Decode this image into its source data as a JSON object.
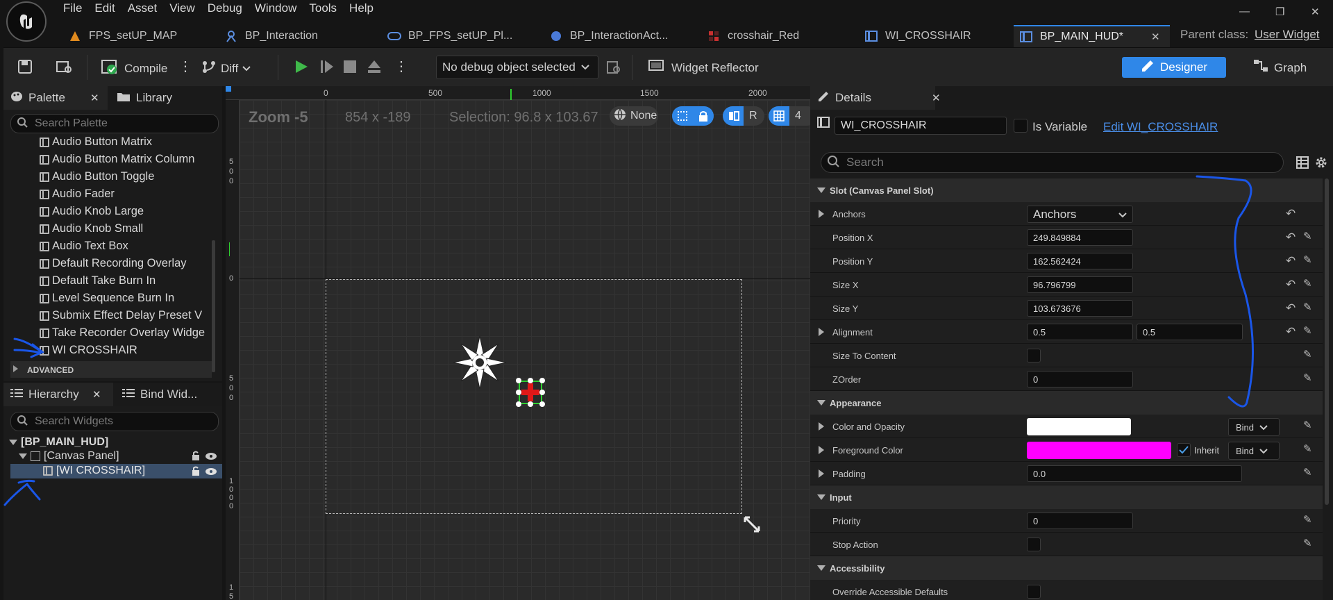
{
  "menu": [
    "File",
    "Edit",
    "Asset",
    "View",
    "Debug",
    "Window",
    "Tools",
    "Help"
  ],
  "window_buttons": {
    "minimize": "—",
    "restore": "❐",
    "close": "✕"
  },
  "tabs": [
    {
      "label": "FPS_setUP_MAP"
    },
    {
      "label": "BP_Interaction"
    },
    {
      "label": "BP_FPS_setUP_Pl..."
    },
    {
      "label": "BP_InteractionAct..."
    },
    {
      "label": "crosshair_Red"
    },
    {
      "label": "WI_CROSSHAIR"
    },
    {
      "label": "BP_MAIN_HUD*"
    }
  ],
  "tab_close": "✕",
  "parent_class": {
    "label": "Parent class:",
    "value": "User Widget"
  },
  "toolbar": {
    "compile": "Compile",
    "diff": "Diff",
    "debug_select": "No debug object selected",
    "widget_reflector": "Widget Reflector",
    "designer": "Designer",
    "graph": "Graph"
  },
  "palette": {
    "tab": "Palette",
    "library_tab": "Library",
    "close": "✕",
    "search_placeholder": "Search Palette",
    "items": [
      "Audio Button Matrix",
      "Audio Button Matrix Column",
      "Audio Button Toggle",
      "Audio Fader",
      "Audio Knob Large",
      "Audio Knob Small",
      "Audio Text Box",
      "Default Recording Overlay",
      "Default Take Burn In",
      "Level Sequence Burn In",
      "Submix Effect Delay Preset V",
      "Take Recorder Overlay Widge",
      "WI CROSSHAIR"
    ],
    "advanced": "ADVANCED"
  },
  "hierarchy": {
    "tab": "Hierarchy",
    "bind_tab": "Bind Wid...",
    "close": "✕",
    "search_placeholder": "Search Widgets",
    "root": "[BP_MAIN_HUD]",
    "canvas": "[Canvas Panel]",
    "child": "[WI CROSSHAIR]"
  },
  "viewport": {
    "zoom": "Zoom -5",
    "coords": "854 x -189",
    "selection": "Selection: 96.8 x 103.67",
    "none": "None",
    "r": "R",
    "grid_num": "4",
    "ruler_top": [
      "0",
      "500",
      "1000",
      "1500",
      "2000"
    ],
    "ruler_left": [
      [
        "5",
        "0",
        "0"
      ],
      [
        "0"
      ],
      [
        "5",
        "0",
        "0"
      ],
      [
        "1",
        "0",
        "0",
        "0"
      ],
      [
        "1",
        "5"
      ]
    ]
  },
  "details": {
    "tab": "Details",
    "close": "✕",
    "widget_name": "WI_CROSSHAIR",
    "is_variable": "Is Variable",
    "edit_link": "Edit WI_CROSSHAIR",
    "search_placeholder": "Search",
    "sections": {
      "slot": "Slot (Canvas Panel Slot)",
      "appearance": "Appearance",
      "input": "Input",
      "accessibility": "Accessibility"
    },
    "anchors_label": "Anchors",
    "anchors_value": "Anchors",
    "pos_x_label": "Position X",
    "pos_x": "249.849884",
    "pos_y_label": "Position Y",
    "pos_y": "162.562424",
    "size_x_label": "Size X",
    "size_x": "96.796799",
    "size_y_label": "Size Y",
    "size_y": "103.673676",
    "alignment_label": "Alignment",
    "align_x": "0.5",
    "align_y": "0.5",
    "size_to_content_label": "Size To Content",
    "zorder_label": "ZOrder",
    "zorder": "0",
    "color_opacity_label": "Color and Opacity",
    "fg_color_label": "Foreground Color",
    "inherit": "Inherit",
    "bind": "Bind",
    "padding_label": "Padding",
    "padding": "0.0",
    "priority_label": "Priority",
    "priority": "0",
    "stop_action_label": "Stop Action",
    "override_label": "Override Accessible Defaults",
    "colors": {
      "color_opacity": "#ffffff",
      "foreground": "#ff00ff",
      "accent": "#2f87e8",
      "annotation": "#1a56e8"
    }
  }
}
